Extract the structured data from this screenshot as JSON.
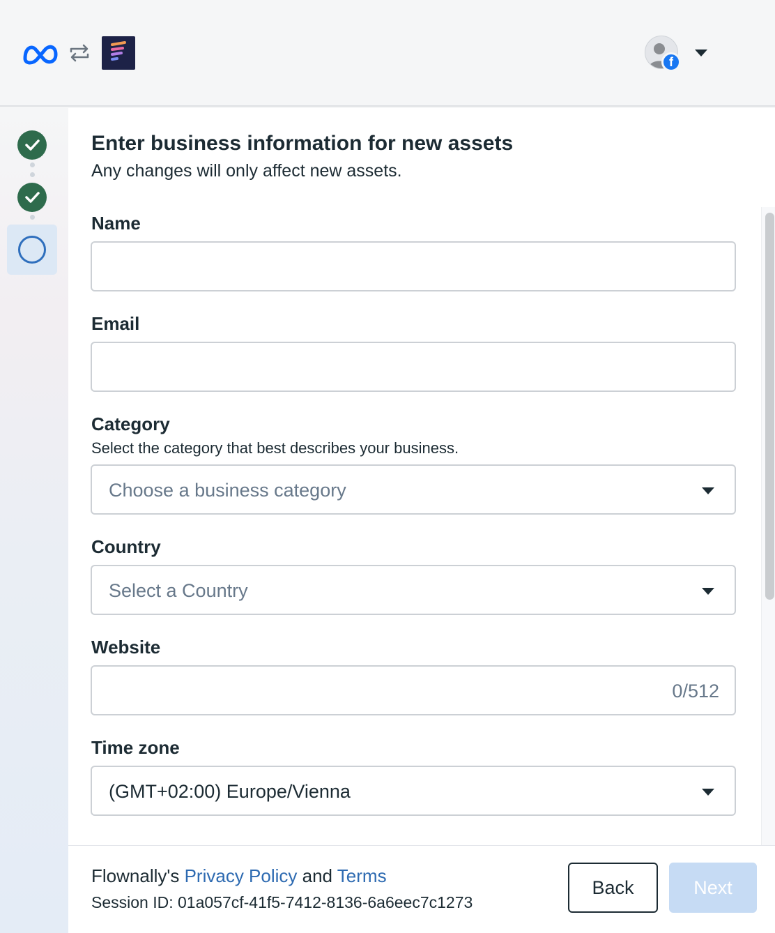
{
  "header": {
    "icons": {
      "meta_logo": "meta-logo-icon",
      "swap": "swap-arrows-icon",
      "app_logo": "flownally-logo-icon",
      "account": "avatar-facebook-icon",
      "caret": "caret-down-icon"
    }
  },
  "stepper": {
    "steps": [
      {
        "status": "complete"
      },
      {
        "status": "complete"
      },
      {
        "status": "current"
      }
    ]
  },
  "form": {
    "title": "Enter business information for new assets",
    "subtitle": "Any changes will only affect new assets.",
    "name": {
      "label": "Name",
      "value": ""
    },
    "email": {
      "label": "Email",
      "value": ""
    },
    "category": {
      "label": "Category",
      "help": "Select the category that best describes your business.",
      "placeholder": "Choose a business category"
    },
    "country": {
      "label": "Country",
      "placeholder": "Select a Country"
    },
    "website": {
      "label": "Website",
      "value": "",
      "counter": "0/512"
    },
    "timezone": {
      "label": "Time zone",
      "value": "(GMT+02:00) Europe/Vienna"
    }
  },
  "footer": {
    "legal_prefix": "Flownally's",
    "privacy_link": "Privacy Policy",
    "and": "and",
    "terms_link": "Terms",
    "session": "Session ID: 01a057cf-41f5-7412-8136-6a6eec7c1273",
    "back_label": "Back",
    "next_label": "Next"
  },
  "colors": {
    "accent_blue": "#1877f2",
    "link": "#2d6ab1",
    "step_complete": "#2e6b4c",
    "step_current": "#2f6fbd",
    "next_disabled": "#c6dbf4"
  }
}
